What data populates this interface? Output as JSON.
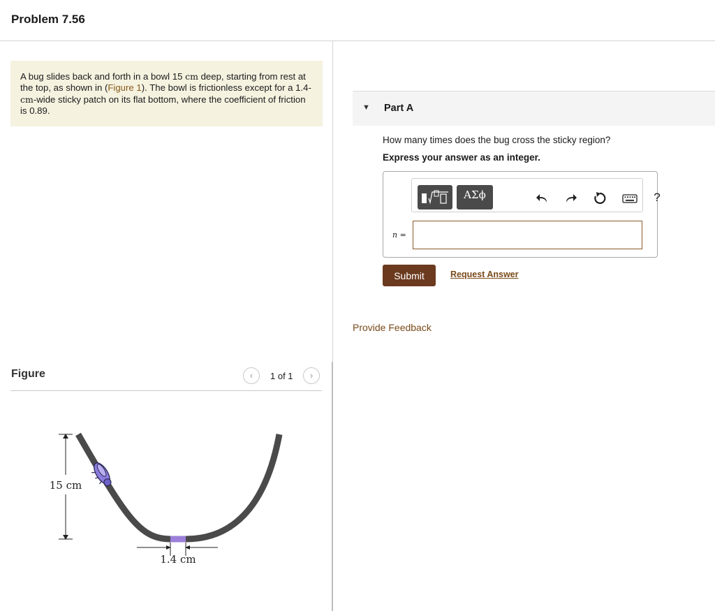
{
  "header": {
    "title": "Problem 7.56"
  },
  "problem": {
    "text_1": "A bug slides back and forth in a bowl 15 ",
    "unit_cm_1": "cm",
    "text_2": " deep, starting from rest at the top, as shown in (",
    "figure_link": "Figure 1",
    "text_3": "). The bowl is frictionless except for a 1.4-",
    "unit_cm_2": "cm",
    "text_4": "-wide sticky patch on its flat bottom, where the coefficient of friction is 0.89."
  },
  "figure": {
    "label": "Figure",
    "prev_icon": "chevron-left-icon",
    "next_icon": "chevron-right-icon",
    "counter": "1 of 1",
    "depth_label": "15 cm",
    "width_label": "1.4 cm",
    "colors": {
      "bowl": "#4a4a4a",
      "sticky": "#9b7fd8",
      "bug": "#7a6ad6"
    }
  },
  "part": {
    "caret_icon": "caret-down-icon",
    "title": "Part A",
    "question": "How many times does the bug cross the sticky region?",
    "instruction": "Express your answer as an integer."
  },
  "toolbar": {
    "templates_icon": "templates-icon",
    "greek_label": "ΑΣϕ",
    "undo_icon": "undo-icon",
    "redo_icon": "redo-icon",
    "reset_icon": "reset-icon",
    "keyboard_icon": "keyboard-icon",
    "help_label": "?"
  },
  "answer": {
    "variable": "n",
    "equals": " =",
    "value": "",
    "placeholder": ""
  },
  "actions": {
    "submit_label": "Submit",
    "request_label": "Request Answer",
    "feedback_label": "Provide Feedback"
  },
  "colors": {
    "accent_brown": "#6b3a1f",
    "link_brown": "#7a4a1a",
    "problem_bg": "#f5f2e0"
  }
}
